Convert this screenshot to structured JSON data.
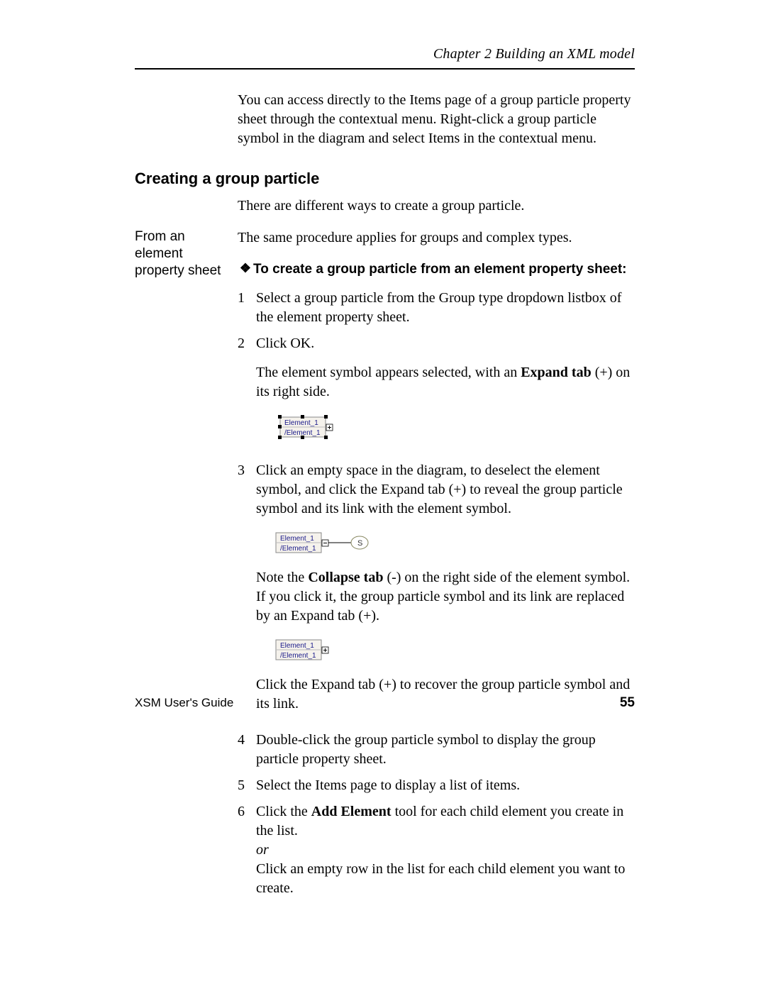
{
  "header": {
    "chapter": "Chapter 2  Building an XML model"
  },
  "intro": "You can access directly to the Items page of a group particle property sheet through the contextual menu. Right-click a group particle symbol in the diagram and select Items in the contextual menu.",
  "section": {
    "title": "Creating a group particle",
    "lead": "There are different ways to create a group particle."
  },
  "sidenote": "From an element property sheet",
  "sameProc": "The same procedure applies for groups and complex types.",
  "taskTitle": "To create a group particle from an element property sheet:",
  "steps": {
    "s1": {
      "num": "1",
      "text": "Select a group particle from the Group type dropdown listbox of the element property sheet."
    },
    "s2": {
      "num": "2",
      "click": "Click OK.",
      "afterA": "The element symbol appears selected, with an ",
      "bold": "Expand tab",
      "afterB": " (+) on its right side."
    },
    "s3": {
      "num": "3",
      "text": "Click an empty space in the diagram, to deselect the element symbol, and click the Expand tab (+) to reveal the group particle symbol and its link with the element symbol.",
      "noteA": "Note the ",
      "noteBold": "Collapse tab",
      "noteB": " (-) on the right side of the element symbol. If you click it, the group particle symbol and its link are replaced by an Expand tab (+).",
      "recover": "Click the Expand tab (+) to recover the group particle symbol and its link."
    },
    "s4": {
      "num": "4",
      "text": "Double-click the group particle symbol to display the group particle property sheet."
    },
    "s5": {
      "num": "5",
      "text": "Select the Items page to display a list of items."
    },
    "s6": {
      "num": "6",
      "textA": "Click the ",
      "bold": "Add Element",
      "textB": " tool for each child element you create in the list.",
      "or": "or",
      "alt": "Click an empty row in the list for each child element you want to create."
    }
  },
  "diagrams": {
    "elem_line1": "Element_1",
    "elem_line2": "/Element_1",
    "seq_glyph": "S"
  },
  "footer": {
    "guide": "XSM User's Guide",
    "page": "55"
  }
}
